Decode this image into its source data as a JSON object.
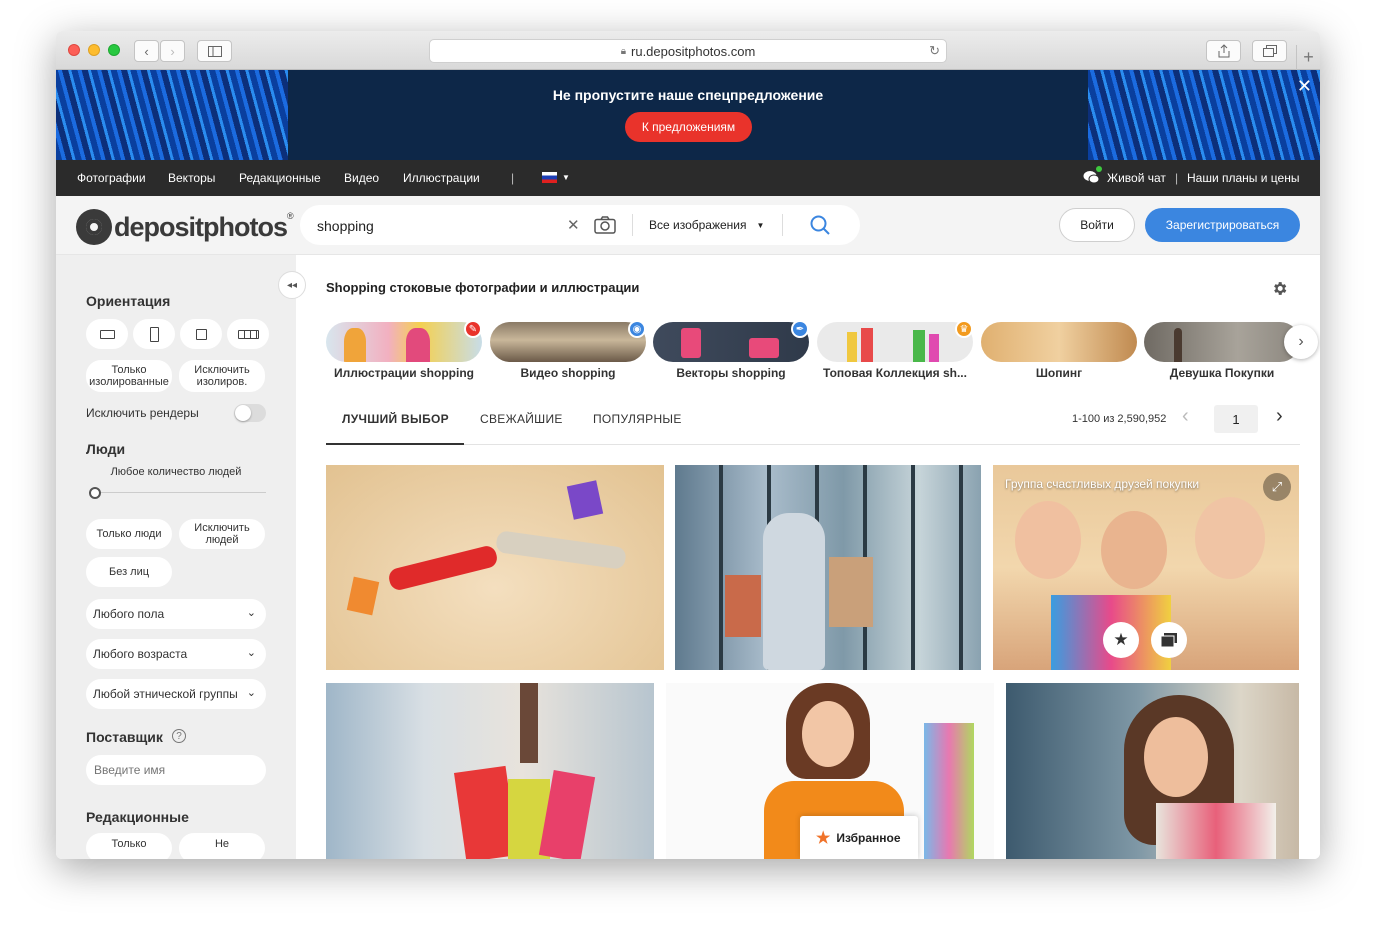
{
  "browser": {
    "url": "ru.depositphotos.com"
  },
  "banner": {
    "title": "Не пропустите наше спецпредложение",
    "cta": "К предложениям"
  },
  "topnav": {
    "items": [
      "Фотографии",
      "Векторы",
      "Редакционные",
      "Видео",
      "Иллюстрации"
    ],
    "separator": "|",
    "chat": "Живой чат",
    "plans_sep": "|",
    "plans": "Наши планы и цены"
  },
  "header": {
    "logo_text": "depositphotos",
    "logo_reg": "®",
    "search_value": "shopping",
    "search_type": "Все изображения",
    "login": "Войти",
    "register": "Зарегистрироваться"
  },
  "sidebar": {
    "orientation_title": "Ориентация",
    "only_isolated": "Только изолированные",
    "exclude_isolated": "Исключить изолиров.",
    "exclude_renders": "Исключить рендеры",
    "people_title": "Люди",
    "people_count": "Любое количество людей",
    "only_people": "Только люди",
    "exclude_people": "Исключить людей",
    "no_faces": "Без лиц",
    "gender": "Любого пола",
    "age": "Любого возраста",
    "ethnicity": "Любой этнической группы",
    "supplier_title": "Поставщик",
    "supplier_help": "?",
    "supplier_placeholder": "Введите имя",
    "editorial_title": "Редакционные",
    "editorial_only": "Только",
    "editorial_not": "Не"
  },
  "main": {
    "heading": "Shopping стоковые фотографии и иллюстрации",
    "categories": [
      {
        "label": "Иллюстрации shopping",
        "badge_color": "#e9332b"
      },
      {
        "label": "Видео shopping",
        "badge_color": "#3b86e0"
      },
      {
        "label": "Векторы shopping",
        "badge_color": "#3b86e0"
      },
      {
        "label": "Топовая Коллекция sh...",
        "badge_color": "#f29a1e"
      },
      {
        "label": "Шопинг",
        "badge_color": ""
      },
      {
        "label": "Девушка Покупки",
        "badge_color": ""
      }
    ],
    "tabs": [
      "ЛУЧШИЙ ВЫБОР",
      "СВЕЖАЙШИЕ",
      "ПОПУЛЯРНЫЕ"
    ],
    "result_count": "1-100 из 2,590,952",
    "page_number": "1",
    "hover_caption": "Группа счастливых друзей покупки",
    "favorites": "Избранное"
  }
}
